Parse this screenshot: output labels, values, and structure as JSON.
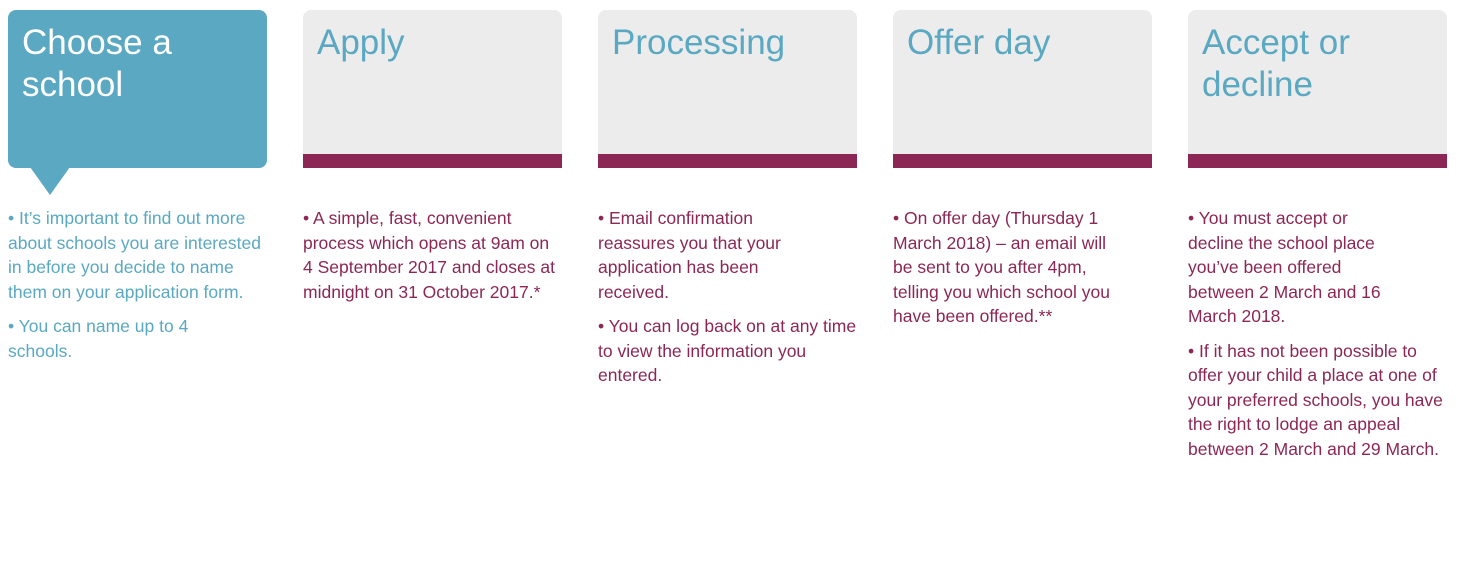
{
  "colors": {
    "accent_teal": "#5aa8c1",
    "accent_maroon": "#8c2755",
    "card_grey": "#ececec",
    "active_title_text": "#ffffff"
  },
  "steps": [
    {
      "title": "Choose a school",
      "active": true,
      "bullets": [
        "• It’s important to find out more about schools you are interested in before you decide to name them on your application form.",
        "• You can name up to 4 schools."
      ]
    },
    {
      "title": "Apply",
      "active": false,
      "bullets": [
        "• A simple, fast, convenient process which opens at 9am on 4 September 2017 and closes at midnight on 31 October 2017.*"
      ]
    },
    {
      "title": "Processing",
      "active": false,
      "bullets": [
        "• Email confirmation reassures you that your application has been received.",
        "• You can log back on at any time to view the information you entered."
      ]
    },
    {
      "title": "Offer day",
      "active": false,
      "bullets": [
        "• On offer day (Thursday 1 March 2018) – an email will be sent to you after 4pm, telling you which school you have been offered.**"
      ]
    },
    {
      "title": "Accept or decline",
      "active": false,
      "bullets": [
        "• You must accept or decline the school place you’ve been offered between 2 March and 16 March 2018.",
        "• If it has not been possible to offer your child a place at one of your preferred schools, you have the right to lodge an appeal between 2 March and 29 March."
      ]
    }
  ]
}
